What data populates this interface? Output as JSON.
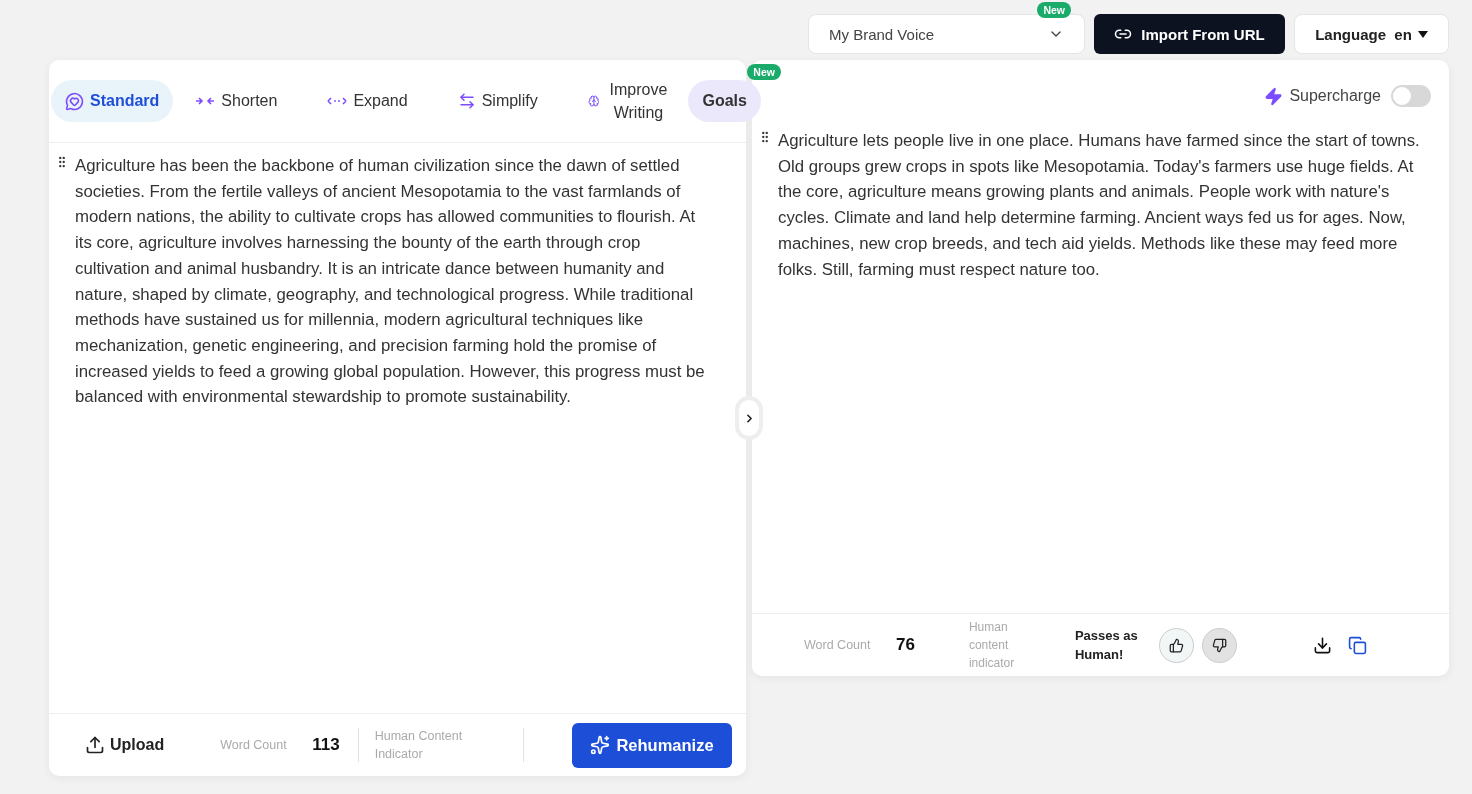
{
  "top_bar": {
    "brand_voice": {
      "label": "My Brand Voice",
      "badge": "New"
    },
    "import_button": "Import From URL",
    "language": {
      "label": "Language",
      "value": "en"
    }
  },
  "input_panel": {
    "tabs": [
      {
        "label": "Standard",
        "kind": "chat",
        "selected": true
      },
      {
        "label": "Shorten",
        "kind": "shorten",
        "selected": false
      },
      {
        "label": "Expand",
        "kind": "expand",
        "selected": false
      },
      {
        "label": "Simplify",
        "kind": "simplify",
        "selected": false
      },
      {
        "label": "Improve Writing",
        "kind": "brain",
        "selected": false
      },
      {
        "label": "Goals",
        "kind": "goals",
        "selected": false,
        "badge": "New"
      }
    ],
    "text": "Agriculture has been the backbone of human civilization since the dawn of settled societies. From the fertile valleys of ancient Mesopotamia to the vast farmlands of modern nations, the ability to cultivate crops has allowed communities to flourish. At its core, agriculture involves harnessing the bounty of the earth through crop cultivation and animal husbandry. It is an intricate dance between humanity and nature, shaped by climate, geography, and technological progress. While traditional methods have sustained us for millennia, modern agricultural techniques like mechanization, genetic engineering, and precision farming hold the promise of increased yields to feed a growing global population. However, this progress must be balanced with environmental stewardship to promote sustainability.",
    "footer": {
      "upload": "Upload",
      "word_count_label": "Word Count",
      "word_count": "113",
      "indicator_label": "Human Content Indicator",
      "rehumanize": "Rehumanize"
    }
  },
  "output_panel": {
    "supercharge": {
      "label": "Supercharge",
      "on": false
    },
    "text": "Agriculture lets people live in one place. Humans have farmed since the start of towns. Old groups grew crops in spots like Mesopotamia. Today's farmers use huge fields. At the core, agriculture means growing plants and animals. People work with nature's cycles. Climate and land help determine farming. Ancient ways fed us for ages. Now, machines, new crop breeds, and tech aid yields. Methods like these may feed more folks. Still, farming must respect nature too.",
    "footer": {
      "word_count_label": "Word Count",
      "word_count": "76",
      "indicator_label": "Human content indicator",
      "verdict": "Passes as Human!",
      "ratings": [
        {
          "kind": "up",
          "selected": false
        },
        {
          "kind": "down",
          "selected": true
        }
      ]
    }
  }
}
